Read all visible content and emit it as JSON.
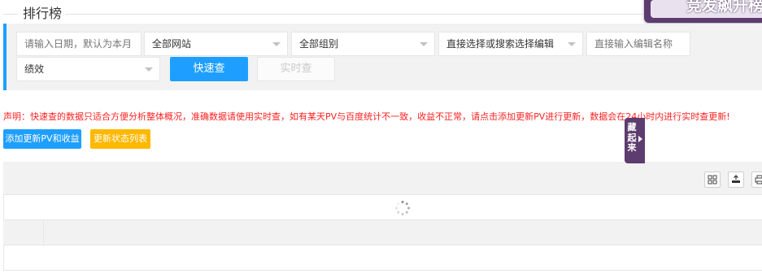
{
  "page": {
    "title": "排行榜"
  },
  "banner": {
    "text": "竞发飙升榜"
  },
  "filters": {
    "date_placeholder": "请输入日期，默认为本月",
    "site_select": "全部网站",
    "group_select": "全部组别",
    "editor_select_placeholder": "直接选择或搜索选择编辑",
    "editor_name_placeholder": "直接输入编辑名称",
    "metric_select": "绩效",
    "quick_query_label": "快速查",
    "realtime_query_label": "实时查"
  },
  "notice": {
    "text": "声明：快速查的数据只适合方便分析整体概况，准确数据请使用实时查，如有某天PV与百度统计不一致，收益不正常，请点击添加更新PV进行更新，数据会在24小时内进行实时查更新!"
  },
  "actions": {
    "add_update_label": "添加更新PV和收益",
    "update_status_label": "更新状态列表"
  },
  "side_tab": {
    "label": "藏起来"
  },
  "table": {
    "toolbar_icons": [
      "columns-icon",
      "export-icon",
      "print-icon"
    ]
  },
  "colors": {
    "primary": "#1e9fff",
    "warning": "#ffb800",
    "danger": "#ff2222",
    "purple": "#5d3c6f"
  }
}
